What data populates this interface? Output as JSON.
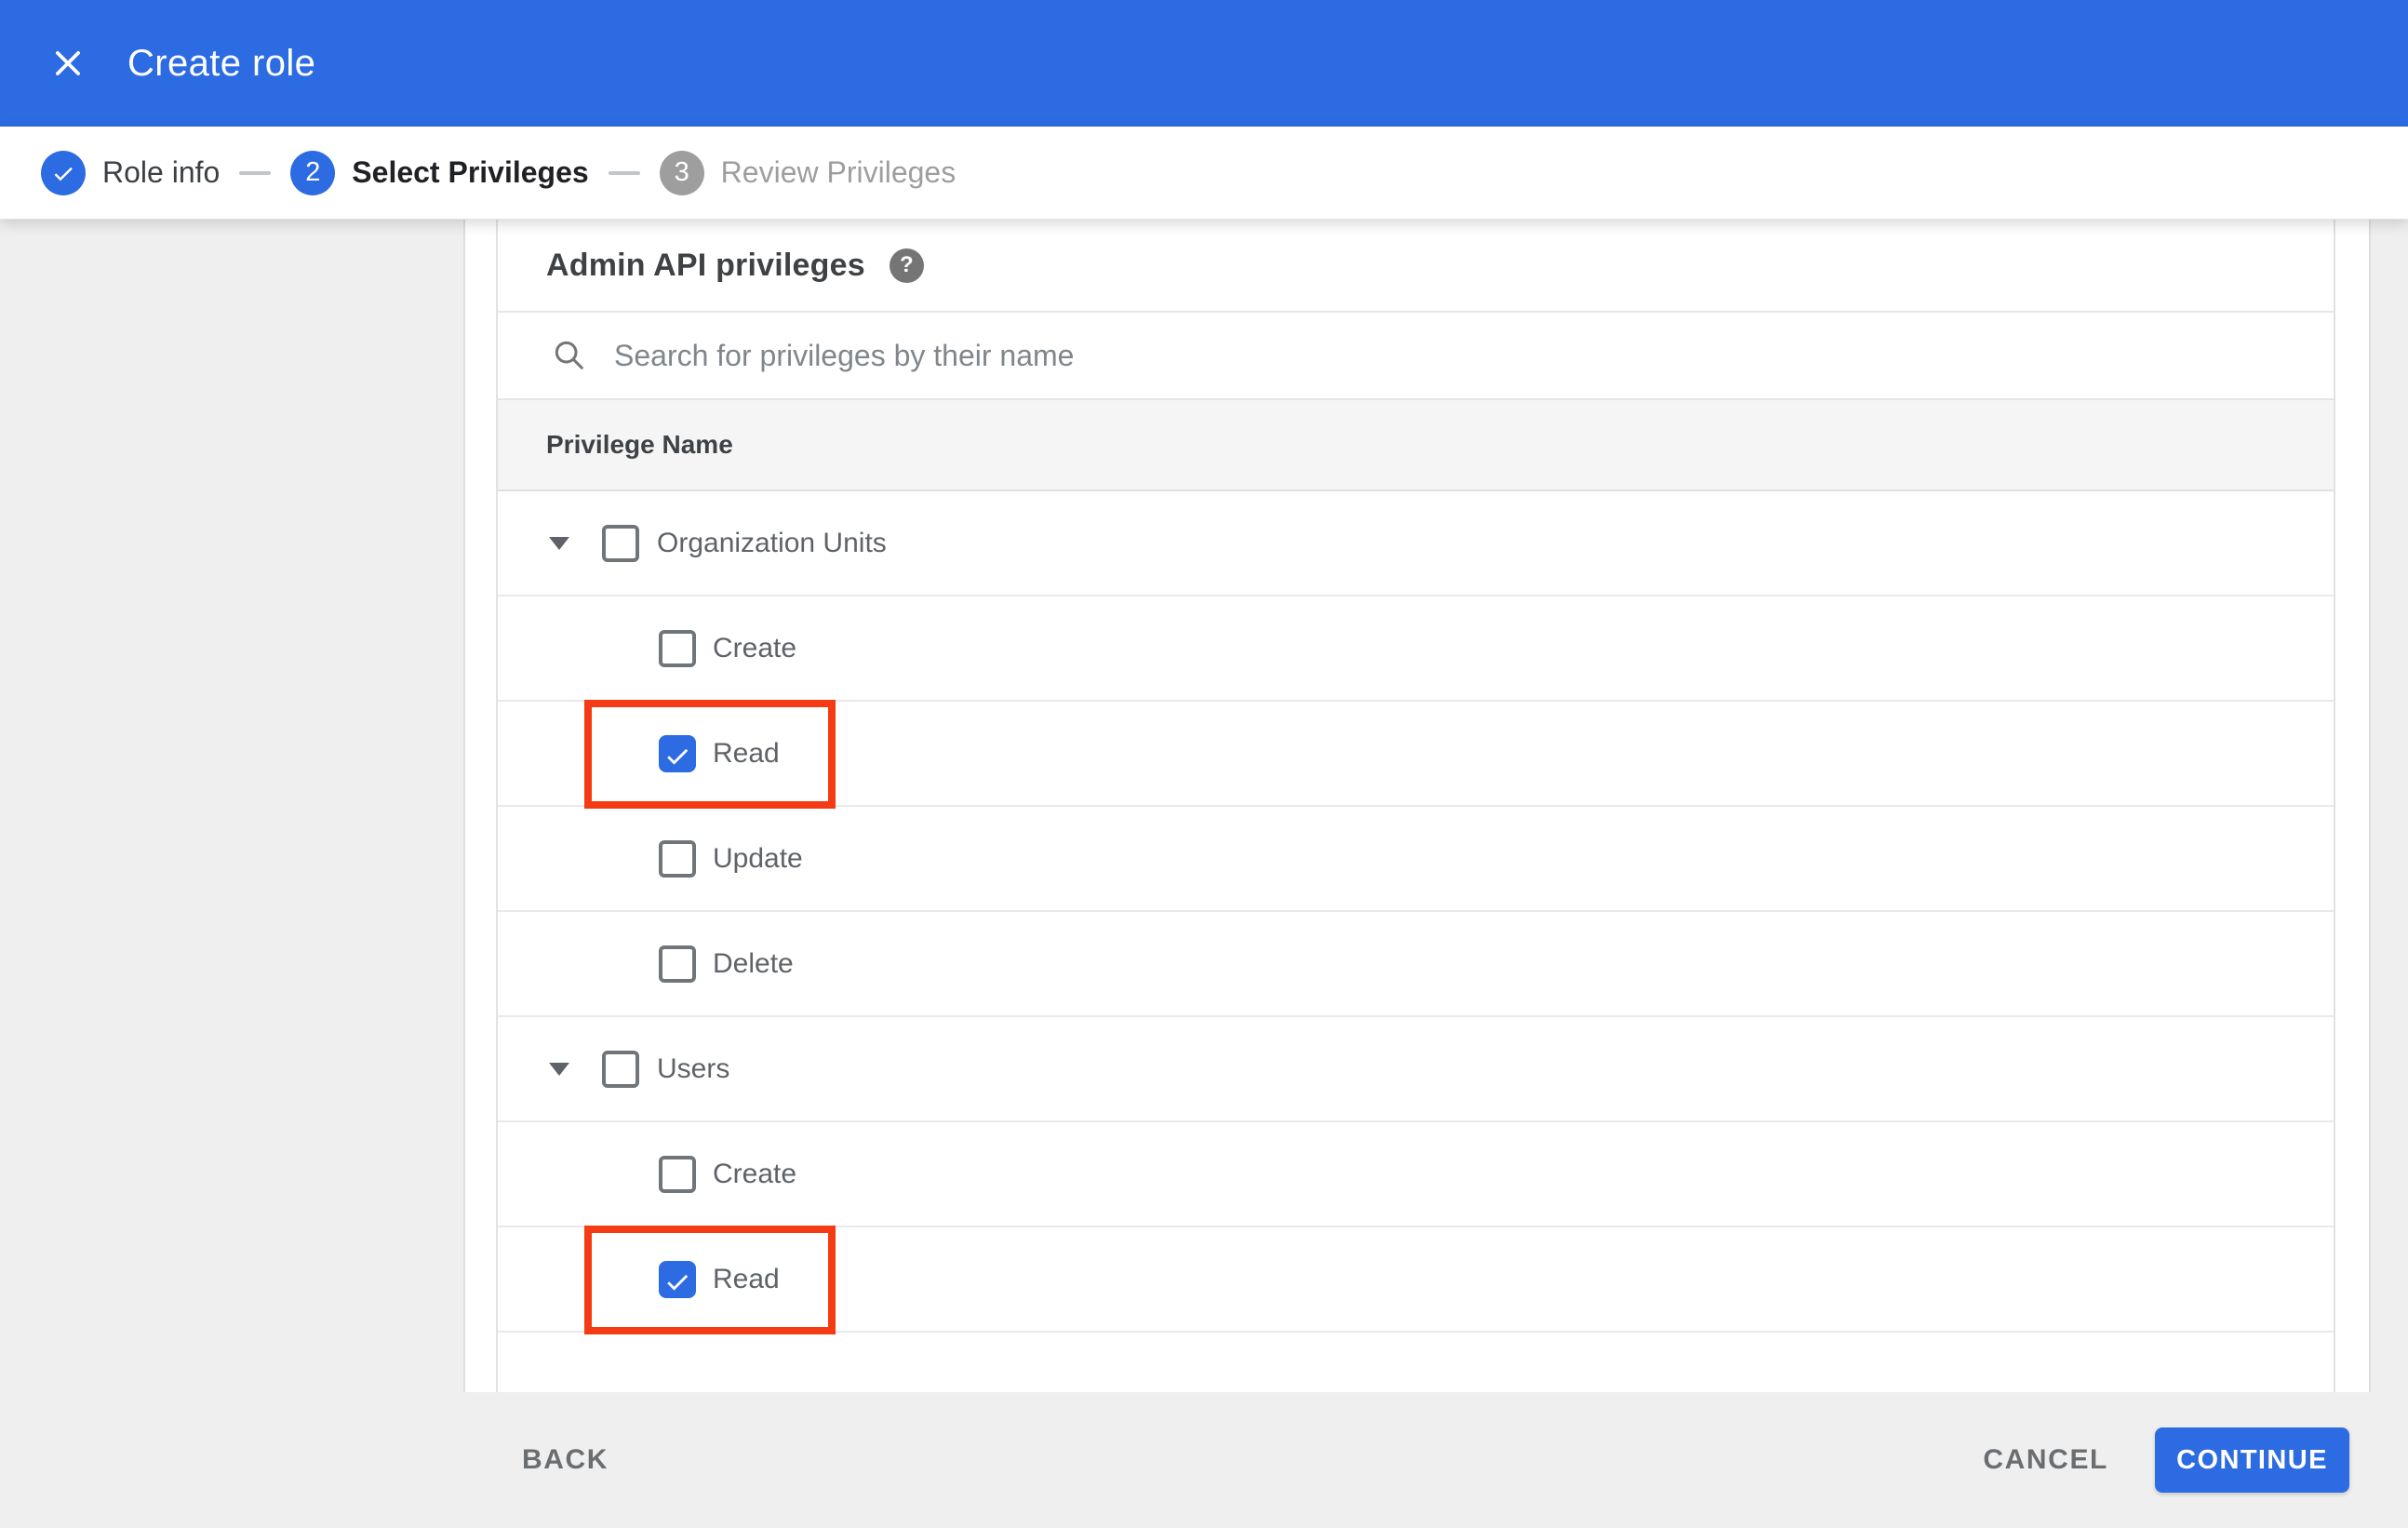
{
  "header": {
    "title": "Create role",
    "close_icon": "close-x"
  },
  "stepper": {
    "steps": [
      {
        "num": "1",
        "label": "Role info",
        "state": "completed",
        "icon": "checkmark"
      },
      {
        "num": "2",
        "label": "Select Privileges",
        "state": "active"
      },
      {
        "num": "3",
        "label": "Review Privileges",
        "state": "upcoming"
      }
    ]
  },
  "content": {
    "section_title": "Admin API privileges",
    "help_icon": "?",
    "search": {
      "placeholder": "Search for privileges by their name",
      "value": "",
      "icon": "magnifier"
    },
    "table": {
      "header": "Privilege Name",
      "rows": [
        {
          "label": "Organization Units",
          "level": "parent",
          "expanded": true,
          "checked": false,
          "highlighted": false
        },
        {
          "label": "Create",
          "level": "child",
          "checked": false,
          "highlighted": false
        },
        {
          "label": "Read",
          "level": "child",
          "checked": true,
          "highlighted": true
        },
        {
          "label": "Update",
          "level": "child",
          "checked": false,
          "highlighted": false
        },
        {
          "label": "Delete",
          "level": "child",
          "checked": false,
          "highlighted": false
        },
        {
          "label": "Users",
          "level": "parent",
          "expanded": true,
          "checked": false,
          "highlighted": false
        },
        {
          "label": "Create",
          "level": "child",
          "checked": false,
          "highlighted": false
        },
        {
          "label": "Read",
          "level": "child",
          "checked": true,
          "highlighted": true
        }
      ]
    }
  },
  "footer": {
    "back_label": "BACK",
    "cancel_label": "CANCEL",
    "continue_label": "CONTINUE"
  },
  "colors": {
    "accent_blue": "#2c6be2",
    "highlight_red": "#f43b14",
    "page_gray": "#efefef",
    "table_header_gray": "#f5f5f6"
  },
  "icons": {
    "close": "✕",
    "caret_expanded": "▼",
    "help": "?",
    "checkmark": "✓"
  }
}
